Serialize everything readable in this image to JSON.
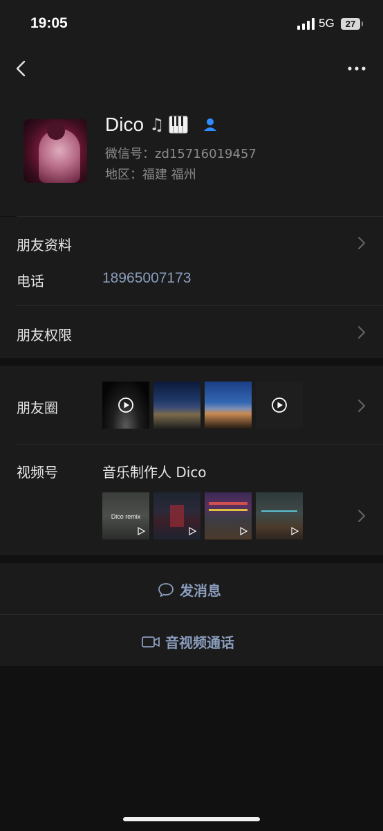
{
  "status_bar": {
    "time": "19:05",
    "network": "5G",
    "battery": "27"
  },
  "nav": {
    "back_icon": "chevron-left-icon",
    "more_icon": "more-dots-icon"
  },
  "profile": {
    "nickname": "Dico",
    "nickname_icons": [
      "music-note-icon",
      "piano-icon"
    ],
    "badge_icon": "friend-badge-icon",
    "wechat_id": "微信号：zd15716019457",
    "region": "地区：福建 福州"
  },
  "info": {
    "friend_profile_label": "朋友资料",
    "phone_label": "电话",
    "phone_value": "18965007173",
    "permissions_label": "朋友权限"
  },
  "moments": {
    "label": "朋友圈",
    "thumbnails": [
      {
        "kind": "video",
        "scene": "night-road"
      },
      {
        "kind": "image",
        "scene": "dusk-river"
      },
      {
        "kind": "image",
        "scene": "dusk-city"
      },
      {
        "kind": "video",
        "scene": "audio-post"
      }
    ]
  },
  "channels": {
    "label": "视频号",
    "name": "音乐制作人 Dico",
    "thumbnails": [
      {
        "caption": "Dico remix"
      },
      {
        "caption": ""
      },
      {
        "caption": ""
      },
      {
        "caption": ""
      }
    ]
  },
  "actions": {
    "message_label": "发消息",
    "message_icon": "chat-bubble-icon",
    "call_label": "音视频通话",
    "call_icon": "video-camera-icon"
  },
  "colors": {
    "background": "#111111",
    "card": "#1b1b1b",
    "link": "#8a9dbd",
    "secondary_text": "#8a8a8a"
  }
}
